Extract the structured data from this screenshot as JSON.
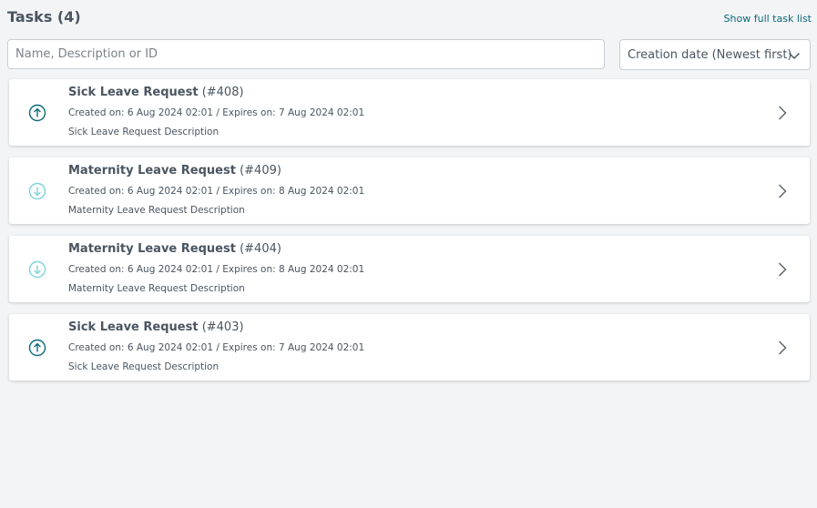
{
  "header": {
    "title": "Tasks (4)",
    "full_list_link": "Show full task list"
  },
  "search": {
    "placeholder": "Name, Description or ID",
    "value": ""
  },
  "sort": {
    "selected": "Creation date (Newest first)"
  },
  "colors": {
    "accent": "#0b6a7a",
    "priority_high": "#0b6a7a",
    "priority_low": "#7fd3dc"
  },
  "tasks": [
    {
      "name": "Sick Leave Request",
      "id": "(#408)",
      "dates": "Created on: 6 Aug 2024 02:01 / Expires on: 7 Aug 2024 02:01",
      "description": "Sick Leave Request Description",
      "priority_icon": "arrow-up-circle-icon"
    },
    {
      "name": "Maternity Leave Request",
      "id": "(#409)",
      "dates": "Created on: 6 Aug 2024 02:01 / Expires on: 8 Aug 2024 02:01",
      "description": "Maternity Leave Request Description",
      "priority_icon": "arrow-down-circle-icon"
    },
    {
      "name": "Maternity Leave Request",
      "id": "(#404)",
      "dates": "Created on: 6 Aug 2024 02:01 / Expires on: 8 Aug 2024 02:01",
      "description": "Maternity Leave Request Description",
      "priority_icon": "arrow-down-circle-icon"
    },
    {
      "name": "Sick Leave Request",
      "id": "(#403)",
      "dates": "Created on: 6 Aug 2024 02:01 / Expires on: 7 Aug 2024 02:01",
      "description": "Sick Leave Request Description",
      "priority_icon": "arrow-up-circle-icon"
    }
  ]
}
